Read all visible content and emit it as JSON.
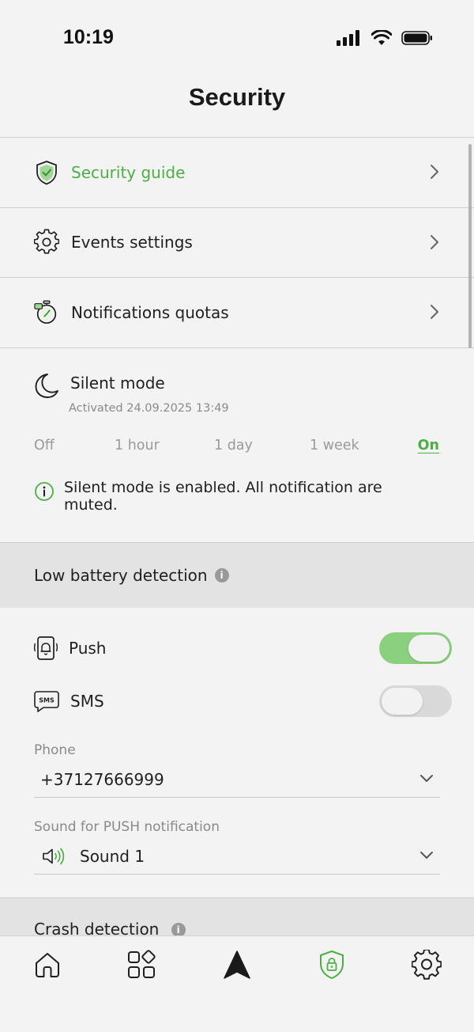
{
  "status_bar": {
    "time": "10:19"
  },
  "header": {
    "title": "Security"
  },
  "menu": [
    {
      "label": "Security guide",
      "icon": "shield-check-icon",
      "accent": true
    },
    {
      "label": "Events settings",
      "icon": "gear-icon"
    },
    {
      "label": "Notifications quotas",
      "icon": "stopwatch-icon"
    }
  ],
  "silent_mode": {
    "title": "Silent mode",
    "subtitle": "Activated 24.09.2025 13:49",
    "options": [
      "Off",
      "1 hour",
      "1 day",
      "1 week",
      "On"
    ],
    "selected": "On",
    "info": "Silent mode is enabled. All notification are muted."
  },
  "low_battery": {
    "title": "Low battery detection",
    "info_badge": "i",
    "push": {
      "label": "Push",
      "enabled": true
    },
    "sms": {
      "label": "SMS",
      "sms_icon_text": "SMS",
      "enabled": false
    },
    "phone": {
      "label": "Phone",
      "value": "+37127666999"
    },
    "sound": {
      "label": "Sound for PUSH notification",
      "value": "Sound 1"
    }
  },
  "crash": {
    "title": "Crash detection",
    "info_badge": "i"
  },
  "colors": {
    "accent": "#4caf44",
    "toggle_on": "#8bd07e",
    "section_bg": "#e3e3e3",
    "background": "#f3f3f3"
  },
  "tab_bar": {
    "tabs": [
      {
        "icon": "home-icon",
        "active": false
      },
      {
        "icon": "apps-grid-icon",
        "active": false
      },
      {
        "icon": "navigation-arrow-icon",
        "active": false
      },
      {
        "icon": "security-shield-icon",
        "active": true
      },
      {
        "icon": "settings-gear-icon",
        "active": false
      }
    ]
  }
}
